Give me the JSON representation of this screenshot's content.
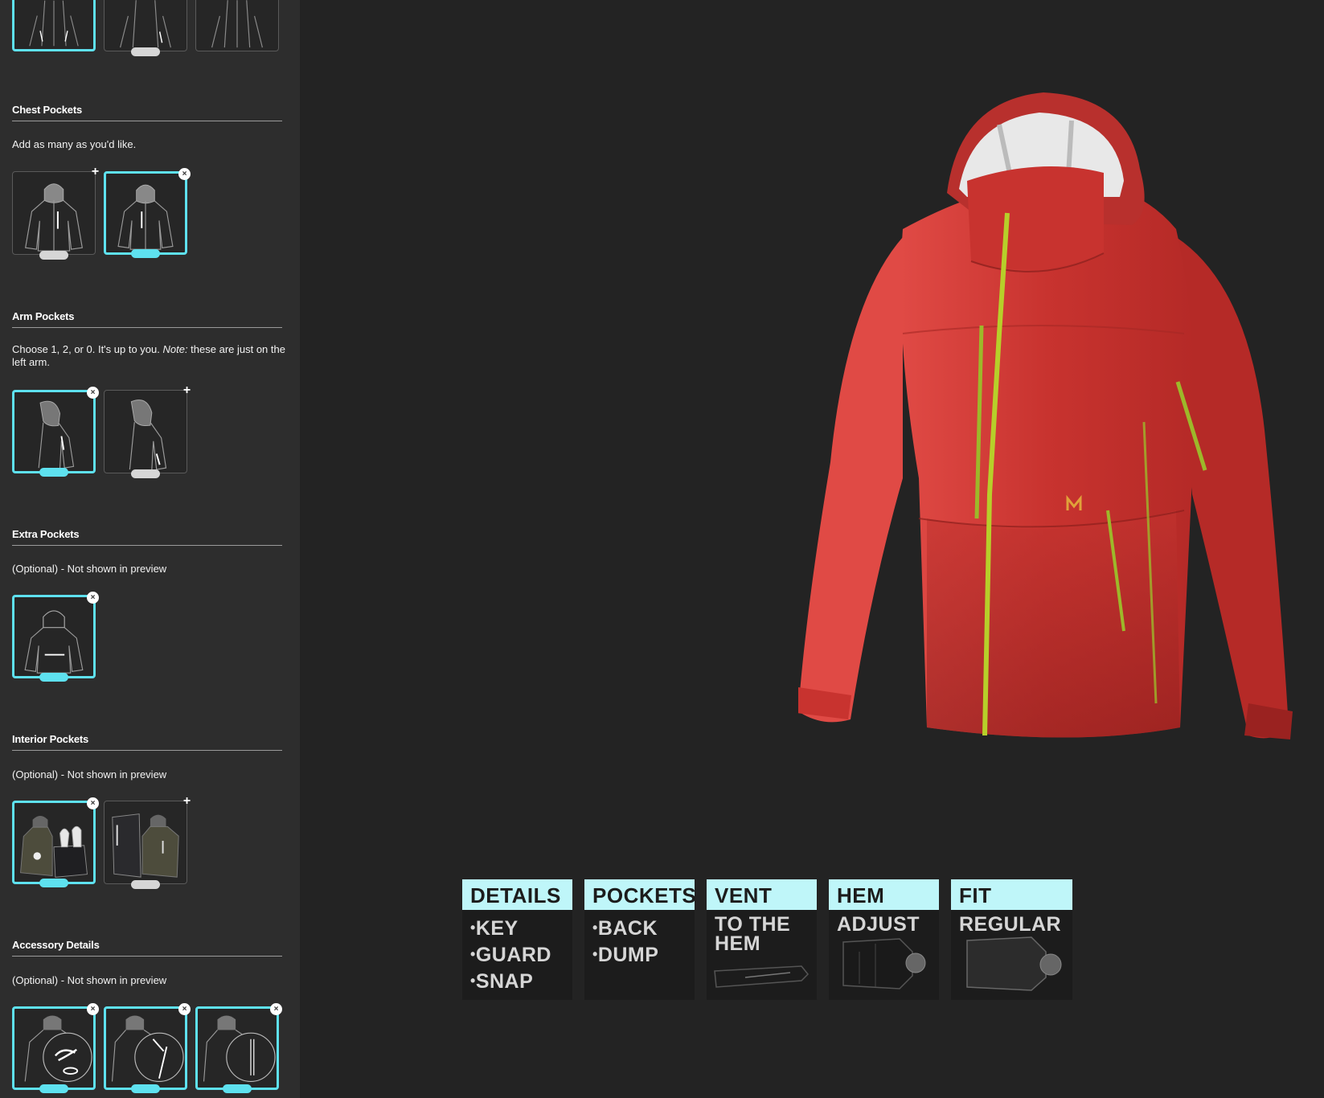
{
  "sidebar": {
    "sections": [
      {
        "title": "Chest Pockets",
        "desc": "Add as many as you'd like."
      },
      {
        "title": "Arm Pockets",
        "desc_pre": "Choose 1, 2, or 0. It's up to you. ",
        "desc_em": "Note:",
        "desc_post": " these are just on the left arm."
      },
      {
        "title": "Extra Pockets",
        "desc": "(Optional) - Not shown in preview"
      },
      {
        "title": "Interior Pockets",
        "desc": "(Optional) - Not shown in preview"
      },
      {
        "title": "Accessory Details",
        "desc": "(Optional) - Not shown in preview"
      }
    ]
  },
  "specs": [
    {
      "title": "DETAILS",
      "items": [
        "KEY",
        "GUARD",
        "SNAP"
      ]
    },
    {
      "title": "POCKETS",
      "items": [
        "BACK",
        "DUMP"
      ]
    },
    {
      "title": "VENT",
      "lines": [
        "TO THE",
        "HEM"
      ]
    },
    {
      "title": "HEM",
      "lines": [
        "ADJUST"
      ]
    },
    {
      "title": "FIT",
      "lines": [
        "REGULAR"
      ]
    }
  ],
  "colors": {
    "accent": "#5ee1ef",
    "jacket": "#c8332f",
    "zipper": "#b7cf2a",
    "logo": "#e0a23a"
  }
}
